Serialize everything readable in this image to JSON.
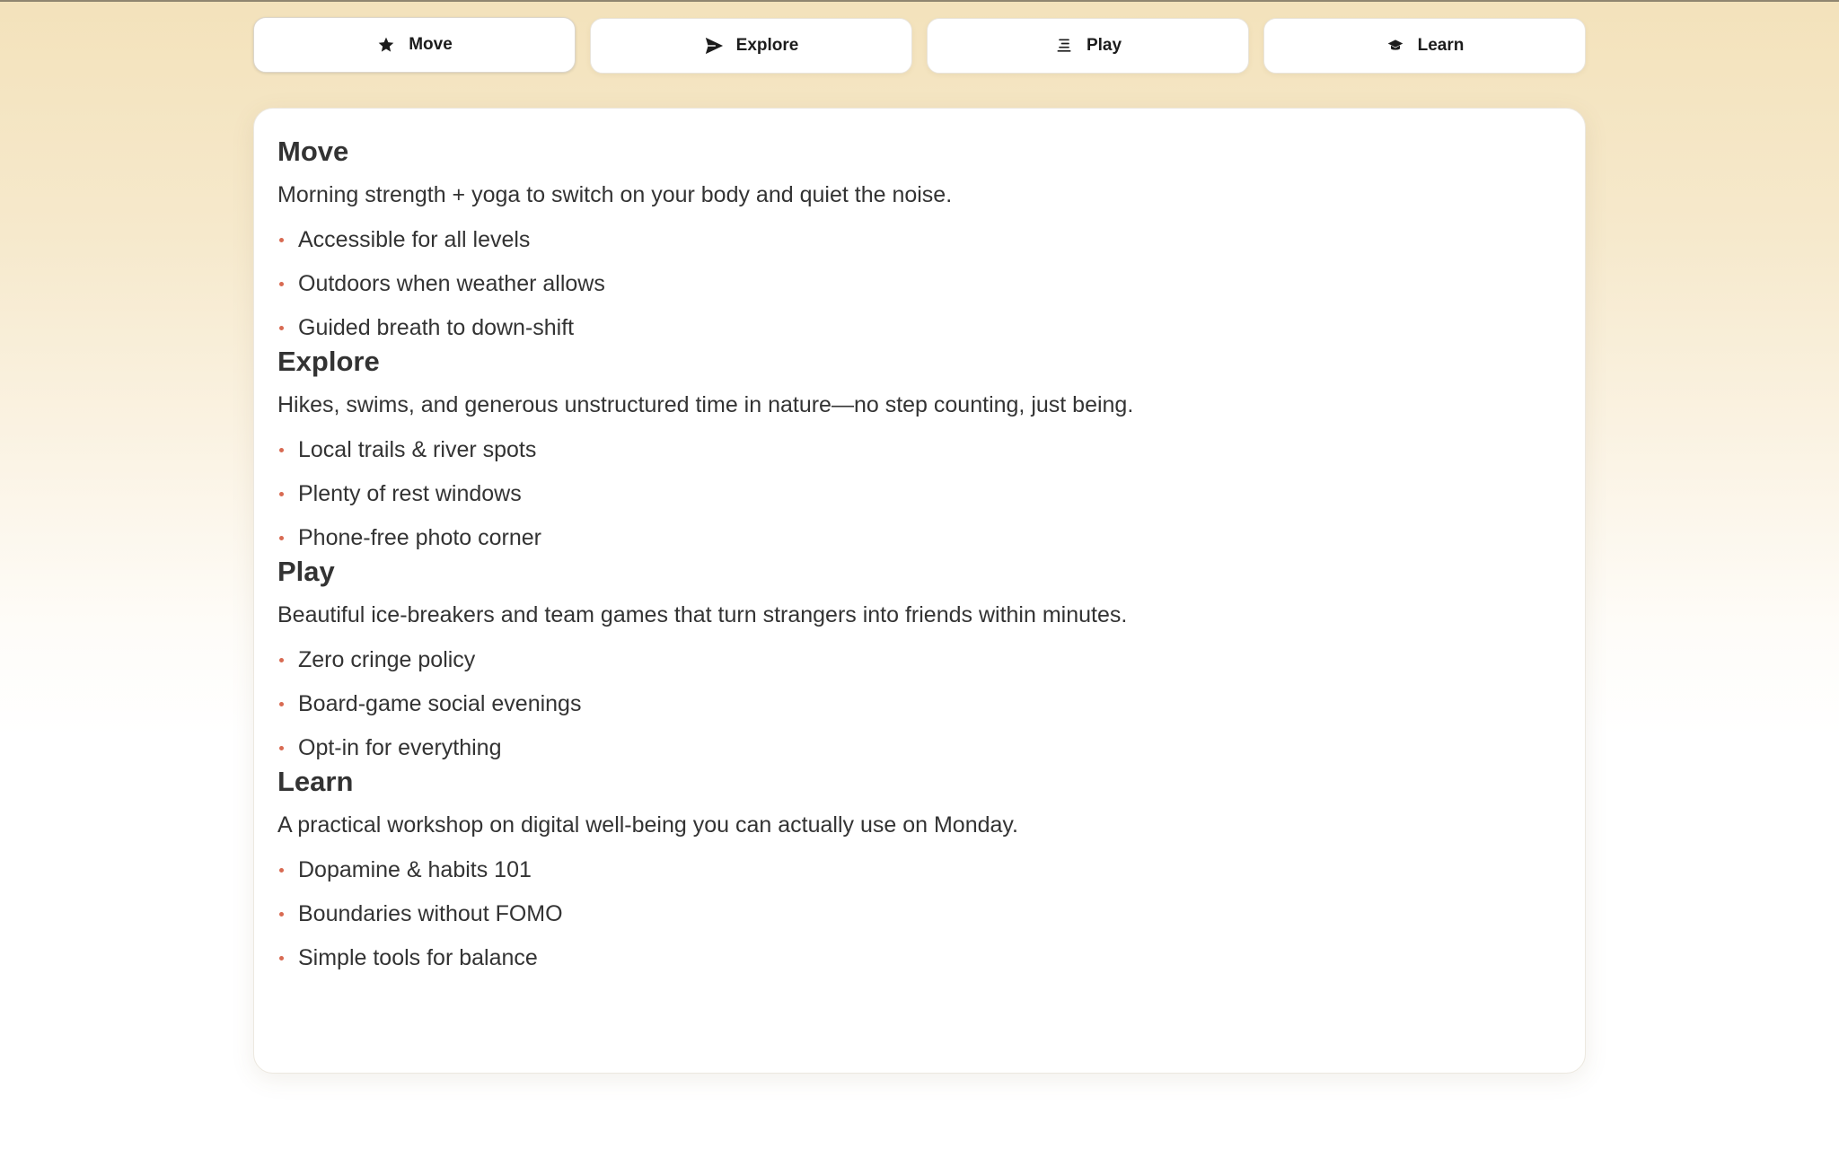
{
  "tabs": [
    {
      "label": "Move",
      "icon": "star-icon",
      "active": true
    },
    {
      "label": "Explore",
      "icon": "send-icon",
      "active": false
    },
    {
      "label": "Play",
      "icon": "list-icon",
      "active": false
    },
    {
      "label": "Learn",
      "icon": "graduation-cap-icon",
      "active": false
    }
  ],
  "sections": [
    {
      "title": "Move",
      "description": "Morning strength + yoga to switch on your body and quiet the noise.",
      "items": [
        "Accessible for all levels",
        "Outdoors when weather allows",
        "Guided breath to down-shift"
      ]
    },
    {
      "title": "Explore",
      "description": "Hikes, swims, and generous unstructured time in nature—no step counting, just being.",
      "items": [
        "Local trails & river spots",
        "Plenty of rest windows",
        "Phone-free photo corner"
      ]
    },
    {
      "title": "Play",
      "description": "Beautiful ice-breakers and team games that turn strangers into friends within minutes.",
      "items": [
        "Zero cringe policy",
        "Board-game social evenings",
        "Opt-in for everything"
      ]
    },
    {
      "title": "Learn",
      "description": "A practical workshop on digital well-being you can actually use on Monday.",
      "items": [
        "Dopamine & habits 101",
        "Boundaries without FOMO",
        "Simple tools for balance"
      ]
    }
  ],
  "colors": {
    "bullet": "#d86a52",
    "text": "#333333",
    "background_top": "#f3e2bb"
  }
}
